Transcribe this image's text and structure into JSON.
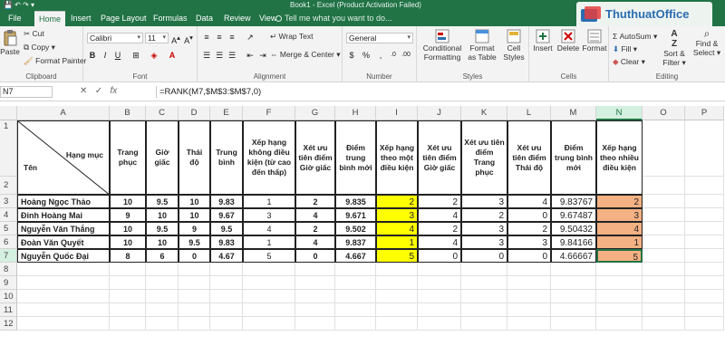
{
  "window": {
    "title": "Book1 - Excel (Product Activation Failed)",
    "watermark": "ThuthuatOffice"
  },
  "tabs": [
    "File",
    "Home",
    "Insert",
    "Page Layout",
    "Formulas",
    "Data",
    "Review",
    "View"
  ],
  "active_tab": "Home",
  "tell_me": "Tell me what you want to do...",
  "ribbon": {
    "clipboard": {
      "paste": "Paste",
      "cut": "Cut",
      "copy": "Copy",
      "format_painter": "Format Painter",
      "label": "Clipboard"
    },
    "font": {
      "name": "Calibri",
      "size": "11",
      "label": "Font",
      "bold": "B",
      "italic": "I",
      "underline": "U"
    },
    "alignment": {
      "wrap": "Wrap Text",
      "merge": "Merge & Center",
      "label": "Alignment"
    },
    "number": {
      "format": "General",
      "label": "Number"
    },
    "styles": {
      "conditional": "Conditional Formatting",
      "format_table": "Format as Table",
      "cell_styles": "Cell Styles",
      "label": "Styles"
    },
    "cells": {
      "insert": "Insert",
      "delete": "Delete",
      "format": "Format",
      "label": "Cells"
    },
    "editing": {
      "autosum": "AutoSum",
      "fill": "Fill",
      "clear": "Clear",
      "sort": "Sort & Filter",
      "find": "Find & Select",
      "label": "Editing"
    }
  },
  "formula_bar": {
    "name_box": "N7",
    "fx": "fx",
    "formula": "=RANK(M7,$M$3:$M$7,0)"
  },
  "columns": [
    "A",
    "B",
    "C",
    "D",
    "E",
    "F",
    "G",
    "H",
    "I",
    "J",
    "K",
    "L",
    "M",
    "N",
    "O",
    "P"
  ],
  "selected_column": "N",
  "rows": [
    "1",
    "2",
    "3",
    "4",
    "5",
    "6",
    "7",
    "8",
    "9",
    "10",
    "11",
    "12"
  ],
  "table": {
    "corner_top": "Hạng mục",
    "corner_bottom": "Tên",
    "headers": [
      "Trang phục",
      "Giờ giấc",
      "Thái độ",
      "Trung bình",
      "Xếp hạng không điều kiện (từ cao đến thấp)",
      "Xét ưu tiên điểm Giờ giấc",
      "Điểm trung bình mới",
      "Xếp hạng theo một điều kiện",
      "Xét ưu tiên điểm Giờ giấc",
      "Xét ưu tiên điểm Trang phục",
      "Xét ưu tiên điểm Thái độ",
      "Điểm trung bình mới",
      "Xếp hạng theo nhiều điều kiện"
    ],
    "data": [
      [
        "Hoàng Ngọc Thảo",
        "10",
        "9.5",
        "10",
        "9.83",
        "1",
        "2",
        "9.835",
        "2",
        "2",
        "3",
        "4",
        "9.83767",
        "2"
      ],
      [
        "Đinh Hoàng Mai",
        "9",
        "10",
        "10",
        "9.67",
        "3",
        "4",
        "9.671",
        "3",
        "4",
        "2",
        "0",
        "9.67487",
        "3"
      ],
      [
        "Nguyễn Văn Thắng",
        "10",
        "9.5",
        "9",
        "9.5",
        "4",
        "2",
        "9.502",
        "4",
        "2",
        "3",
        "2",
        "9.50432",
        "4"
      ],
      [
        "Đoàn Văn Quyết",
        "10",
        "10",
        "9.5",
        "9.83",
        "1",
        "4",
        "9.837",
        "1",
        "4",
        "3",
        "3",
        "9.84166",
        "1"
      ],
      [
        "Nguyễn Quốc Đại",
        "8",
        "6",
        "0",
        "4.67",
        "5",
        "0",
        "4.667",
        "5",
        "0",
        "0",
        "0",
        "4.66667",
        "5"
      ]
    ]
  }
}
